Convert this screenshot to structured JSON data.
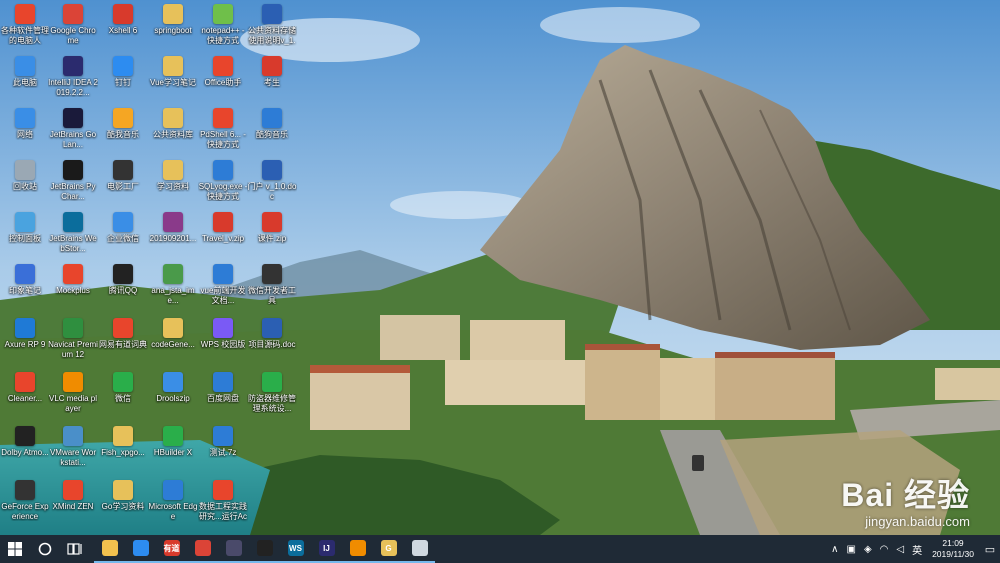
{
  "desktop_icons": [
    {
      "label": "各种软件管理的电脑人",
      "icon": "app-grid-icon",
      "color": "#e8452c",
      "col": 0,
      "row": 0
    },
    {
      "label": "此电脑",
      "icon": "computer-icon",
      "color": "#3a8ee6",
      "col": 0,
      "row": 1
    },
    {
      "label": "网络",
      "icon": "network-icon",
      "color": "#3a8ee6",
      "col": 0,
      "row": 2
    },
    {
      "label": "回收站",
      "icon": "recycle-bin-icon",
      "color": "#9aa8b4",
      "col": 0,
      "row": 3
    },
    {
      "label": "控制面板",
      "icon": "control-panel-icon",
      "color": "#4aa3df",
      "col": 0,
      "row": 4
    },
    {
      "label": "印象笔记",
      "icon": "note-icon",
      "color": "#3a6fd8",
      "col": 0,
      "row": 5
    },
    {
      "label": "Axure RP 9",
      "icon": "axure-icon",
      "color": "#1f7ad6",
      "col": 0,
      "row": 6
    },
    {
      "label": "Cleaner...",
      "icon": "cleaner-icon",
      "color": "#e8452c",
      "col": 0,
      "row": 7
    },
    {
      "label": "Dolby Atmo...",
      "icon": "dolby-icon",
      "color": "#222222",
      "col": 0,
      "row": 8
    },
    {
      "label": "GeForce Experience",
      "icon": "geforce-icon",
      "color": "#333333",
      "col": 0,
      "row": 9
    },
    {
      "label": "Google Chrome",
      "icon": "chrome-icon",
      "color": "#db4437",
      "col": 1,
      "row": 0
    },
    {
      "label": "IntelliJ IDEA 2019.2.2...",
      "icon": "intellij-icon",
      "color": "#2b2b6e",
      "col": 1,
      "row": 1
    },
    {
      "label": "JetBrains GoLan...",
      "icon": "goland-icon",
      "color": "#1a1a3a",
      "col": 1,
      "row": 2
    },
    {
      "label": "JetBrains PyChar...",
      "icon": "pycharm-icon",
      "color": "#1a1a1a",
      "col": 1,
      "row": 3
    },
    {
      "label": "JetBrains WebStor...",
      "icon": "webstorm-icon",
      "color": "#0b6d9c",
      "col": 1,
      "row": 4
    },
    {
      "label": "Mockplus",
      "icon": "mockplus-icon",
      "color": "#e8452c",
      "col": 1,
      "row": 5
    },
    {
      "label": "Navicat Premium 12",
      "icon": "navicat-icon",
      "color": "#2f8f3f",
      "col": 1,
      "row": 6
    },
    {
      "label": "VLC media player",
      "icon": "vlc-icon",
      "color": "#f08c00",
      "col": 1,
      "row": 7
    },
    {
      "label": "VMware Workstati...",
      "icon": "vmware-icon",
      "color": "#4a8fc9",
      "col": 1,
      "row": 8
    },
    {
      "label": "XMind ZEN",
      "icon": "xmind-icon",
      "color": "#e8452c",
      "col": 1,
      "row": 9
    },
    {
      "label": "Xshell 6",
      "icon": "xshell-icon",
      "color": "#d83a2c",
      "col": 2,
      "row": 0
    },
    {
      "label": "钉钉",
      "icon": "dingtalk-icon",
      "color": "#2d8cf0",
      "col": 2,
      "row": 1
    },
    {
      "label": "酷我音乐",
      "icon": "music-icon",
      "color": "#f5a623",
      "col": 2,
      "row": 2
    },
    {
      "label": "电影工厂",
      "icon": "film-icon",
      "color": "#333333",
      "col": 2,
      "row": 3
    },
    {
      "label": "企业微信",
      "icon": "wecom-icon",
      "color": "#3a8ee6",
      "col": 2,
      "row": 4
    },
    {
      "label": "腾讯QQ",
      "icon": "qq-icon",
      "color": "#222222",
      "col": 2,
      "row": 5
    },
    {
      "label": "网易有道词典",
      "icon": "dict-icon",
      "color": "#e8452c",
      "col": 2,
      "row": 6
    },
    {
      "label": "微信",
      "icon": "wechat-icon",
      "color": "#2aae4a",
      "col": 2,
      "row": 7
    },
    {
      "label": "Fish_xpgo...",
      "icon": "folder-icon",
      "color": "#e7c15a",
      "col": 2,
      "row": 8
    },
    {
      "label": "Go学习资料",
      "icon": "folder-icon",
      "color": "#e7c15a",
      "col": 2,
      "row": 9
    },
    {
      "label": "springboot",
      "icon": "folder-icon",
      "color": "#e7c15a",
      "col": 3,
      "row": 0
    },
    {
      "label": "Vue学习笔记",
      "icon": "folder-icon",
      "color": "#e7c15a",
      "col": 3,
      "row": 1
    },
    {
      "label": "公共资料库",
      "icon": "folder-icon",
      "color": "#e7c15a",
      "col": 3,
      "row": 2
    },
    {
      "label": "学习资料",
      "icon": "folder-icon",
      "color": "#e7c15a",
      "col": 3,
      "row": 3
    },
    {
      "label": "201909201...",
      "icon": "archive-icon",
      "color": "#8a3a8a",
      "col": 3,
      "row": 4
    },
    {
      "label": "ana_jsta_ime...",
      "icon": "script-icon",
      "color": "#4a9a4a",
      "col": 3,
      "row": 5
    },
    {
      "label": "codeGene...",
      "icon": "folder-icon",
      "color": "#e7c15a",
      "col": 3,
      "row": 6
    },
    {
      "label": "Droolszip",
      "icon": "zip-icon",
      "color": "#3a8ee6",
      "col": 3,
      "row": 7
    },
    {
      "label": "HBuilder X",
      "icon": "hbuilder-icon",
      "color": "#2aae4a",
      "col": 3,
      "row": 8
    },
    {
      "label": "Microsoft Edge",
      "icon": "edge-icon",
      "color": "#2d7cd6",
      "col": 3,
      "row": 9
    },
    {
      "label": "notepad++ - 快捷方式",
      "icon": "notepad-icon",
      "color": "#6fbf4a",
      "col": 4,
      "row": 0
    },
    {
      "label": "Office助手",
      "icon": "office-icon",
      "color": "#e8452c",
      "col": 4,
      "row": 1
    },
    {
      "label": "PdShell 6... - 快捷方式",
      "icon": "shortcut-icon",
      "color": "#e8452c",
      "col": 4,
      "row": 2
    },
    {
      "label": "SQLyog.exe - 快捷方式",
      "icon": "sqlyog-icon",
      "color": "#2d7cd6",
      "col": 4,
      "row": 3
    },
    {
      "label": "Travel_v.zip",
      "icon": "zip-icon",
      "color": "#d83a2c",
      "col": 4,
      "row": 4
    },
    {
      "label": "vue前端开发文档...",
      "icon": "doc-icon",
      "color": "#2d7cd6",
      "col": 4,
      "row": 5
    },
    {
      "label": "WPS 校园版",
      "icon": "wps-icon",
      "color": "#7a5af5",
      "col": 4,
      "row": 6
    },
    {
      "label": "百度网盘",
      "icon": "baidu-netdisk-icon",
      "color": "#2d7cd6",
      "col": 4,
      "row": 7
    },
    {
      "label": "测试.7z",
      "icon": "archive-icon",
      "color": "#2d7cd6",
      "col": 4,
      "row": 8
    },
    {
      "label": "数据工程实践研究...运行Acti...",
      "icon": "pdf-icon",
      "color": "#e8452c",
      "col": 4,
      "row": 9
    },
    {
      "label": "公共资料存储使用说明v_1.0...",
      "icon": "word-icon",
      "color": "#2b5fb3",
      "col": 5,
      "row": 0
    },
    {
      "label": "考生",
      "icon": "archive-icon",
      "color": "#d83a2c",
      "col": 5,
      "row": 1
    },
    {
      "label": "酷狗音乐",
      "icon": "kugou-icon",
      "color": "#2d7cd6",
      "col": 5,
      "row": 2
    },
    {
      "label": "门户 v_1.0.doc",
      "icon": "word-icon",
      "color": "#2b5fb3",
      "col": 5,
      "row": 3
    },
    {
      "label": "课件.zip",
      "icon": "zip-icon",
      "color": "#d83a2c",
      "col": 5,
      "row": 4
    },
    {
      "label": "微信开发者工具",
      "icon": "wechat-devtools-icon",
      "color": "#333333",
      "col": 5,
      "row": 5
    },
    {
      "label": "项目源码.doc",
      "icon": "word-icon",
      "color": "#2b5fb3",
      "col": 5,
      "row": 6
    },
    {
      "label": "防盗器维修管理系统设...",
      "icon": "app-icon",
      "color": "#2aae4a",
      "col": 5,
      "row": 7
    }
  ],
  "watermark": {
    "logo": "Bai 经验",
    "url": "jingyan.baidu.com"
  },
  "taskbar": {
    "start_icon": "windows-start-icon",
    "apps": [
      {
        "name": "file-explorer-icon",
        "color": "#f2c14e",
        "text": ""
      },
      {
        "name": "search-app-icon",
        "color": "#2d8cf0",
        "text": ""
      },
      {
        "name": "dict-taskbar-icon",
        "color": "#d83a2c",
        "text": "有道"
      },
      {
        "name": "chrome-taskbar-icon",
        "color": "#db4437",
        "text": ""
      },
      {
        "name": "media-taskbar-icon",
        "color": "#4a4a6a",
        "text": ""
      },
      {
        "name": "terminal-taskbar-icon",
        "color": "#222222",
        "text": ""
      },
      {
        "name": "webstorm-taskbar-icon",
        "color": "#0b6d9c",
        "text": "WS"
      },
      {
        "name": "intellij-taskbar-icon",
        "color": "#2b2b6e",
        "text": "IJ"
      },
      {
        "name": "pinwheel-taskbar-icon",
        "color": "#f08c00",
        "text": ""
      },
      {
        "name": "goland-taskbar-icon",
        "color": "#e7c15a",
        "text": "G"
      },
      {
        "name": "device-taskbar-icon",
        "color": "#cfd8e0",
        "text": ""
      }
    ],
    "tray": {
      "ime": "英",
      "time": "21:09",
      "date": "2019/11/30"
    }
  }
}
